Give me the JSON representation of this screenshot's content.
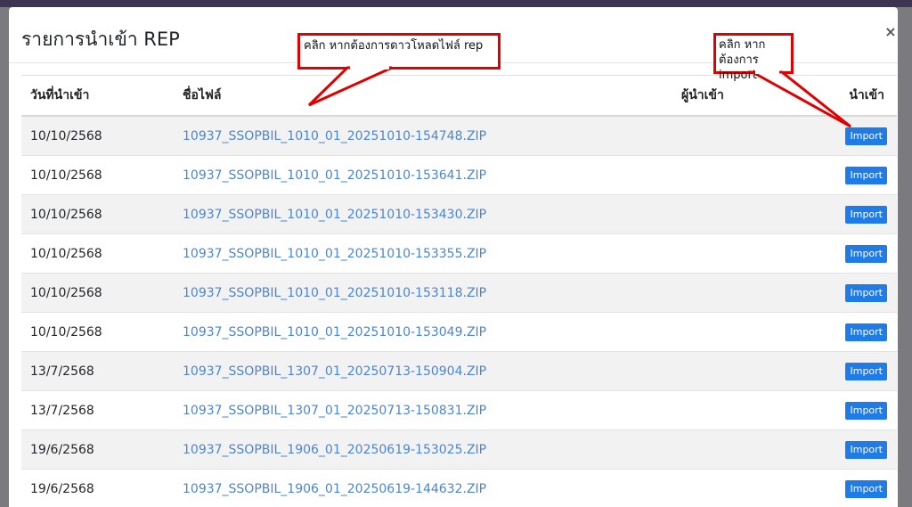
{
  "modal": {
    "title": "รายการนำเข้า REP",
    "close_label": "×"
  },
  "annotations": {
    "download_hint": "คลิก หากต้องการดาวโหลดไฟล์ rep",
    "import_hint": "คลิก หากต้องการ import"
  },
  "table": {
    "headers": [
      "วันที่นำเข้า",
      "ชื่อไฟล์",
      "ผู้นำเข้า",
      "นำเข้า"
    ],
    "rows": [
      {
        "date": "10/10/2568",
        "file": "10937_SSOPBIL_1010_01_20251010-154748.ZIP",
        "user": "",
        "action": "Import"
      },
      {
        "date": "10/10/2568",
        "file": "10937_SSOPBIL_1010_01_20251010-153641.ZIP",
        "user": "",
        "action": "Import"
      },
      {
        "date": "10/10/2568",
        "file": "10937_SSOPBIL_1010_01_20251010-153430.ZIP",
        "user": "",
        "action": "Import"
      },
      {
        "date": "10/10/2568",
        "file": "10937_SSOPBIL_1010_01_20251010-153355.ZIP",
        "user": "",
        "action": "Import"
      },
      {
        "date": "10/10/2568",
        "file": "10937_SSOPBIL_1010_01_20251010-153118.ZIP",
        "user": "",
        "action": "Import"
      },
      {
        "date": "10/10/2568",
        "file": "10937_SSOPBIL_1010_01_20251010-153049.ZIP",
        "user": "",
        "action": "Import"
      },
      {
        "date": "13/7/2568",
        "file": "10937_SSOPBIL_1307_01_20250713-150904.ZIP",
        "user": "",
        "action": "Import"
      },
      {
        "date": "13/7/2568",
        "file": "10937_SSOPBIL_1307_01_20250713-150831.ZIP",
        "user": "",
        "action": "Import"
      },
      {
        "date": "19/6/2568",
        "file": "10937_SSOPBIL_1906_01_20250619-153025.ZIP",
        "user": "",
        "action": "Import"
      },
      {
        "date": "19/6/2568",
        "file": "10937_SSOPBIL_1906_01_20250619-144632.ZIP",
        "user": "",
        "action": "Import"
      }
    ]
  },
  "colors": {
    "link": "#4a86d1",
    "import_button": "#1f7be6",
    "annotation": "#e00000"
  }
}
